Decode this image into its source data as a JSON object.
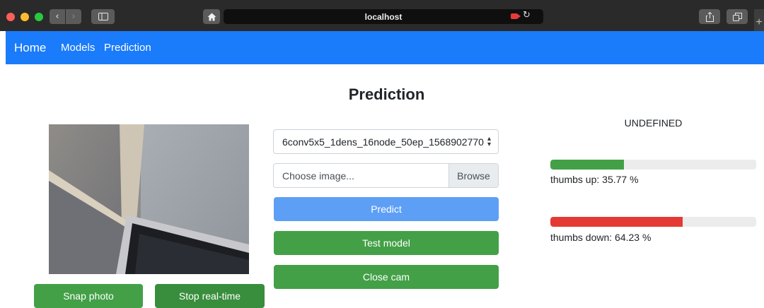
{
  "browser": {
    "address": "localhost",
    "icons": {
      "back": "chevron-left-icon",
      "forward": "chevron-right-icon",
      "sidebar": "sidebar-icon",
      "home": "home-icon",
      "camera": "camera-recording-icon",
      "reload": "reload-icon",
      "share": "share-icon",
      "tabs": "tabs-icon",
      "new_tab": "plus-icon"
    }
  },
  "navbar": {
    "brand": "Home",
    "links": [
      "Models",
      "Prediction"
    ],
    "color": "#1a7bfb"
  },
  "page": {
    "title": "Prediction"
  },
  "camera": {
    "snap_label": "Snap photo",
    "stop_label": "Stop real-time"
  },
  "controls": {
    "model_selected": "6conv5x5_1dens_16node_50ep_1568902770",
    "file_placeholder": "Choose image...",
    "browse_label": "Browse",
    "predict_label": "Predict",
    "test_label": "Test model",
    "close_cam_label": "Close cam"
  },
  "results": {
    "label": "UNDEFINED",
    "classes": [
      {
        "name": "thumbs up",
        "percent": 35.77,
        "text": "thumbs up: 35.77 %",
        "color": "#43a047"
      },
      {
        "name": "thumbs down",
        "percent": 64.23,
        "text": "thumbs down: 64.23 %",
        "color": "#e53935"
      }
    ]
  }
}
